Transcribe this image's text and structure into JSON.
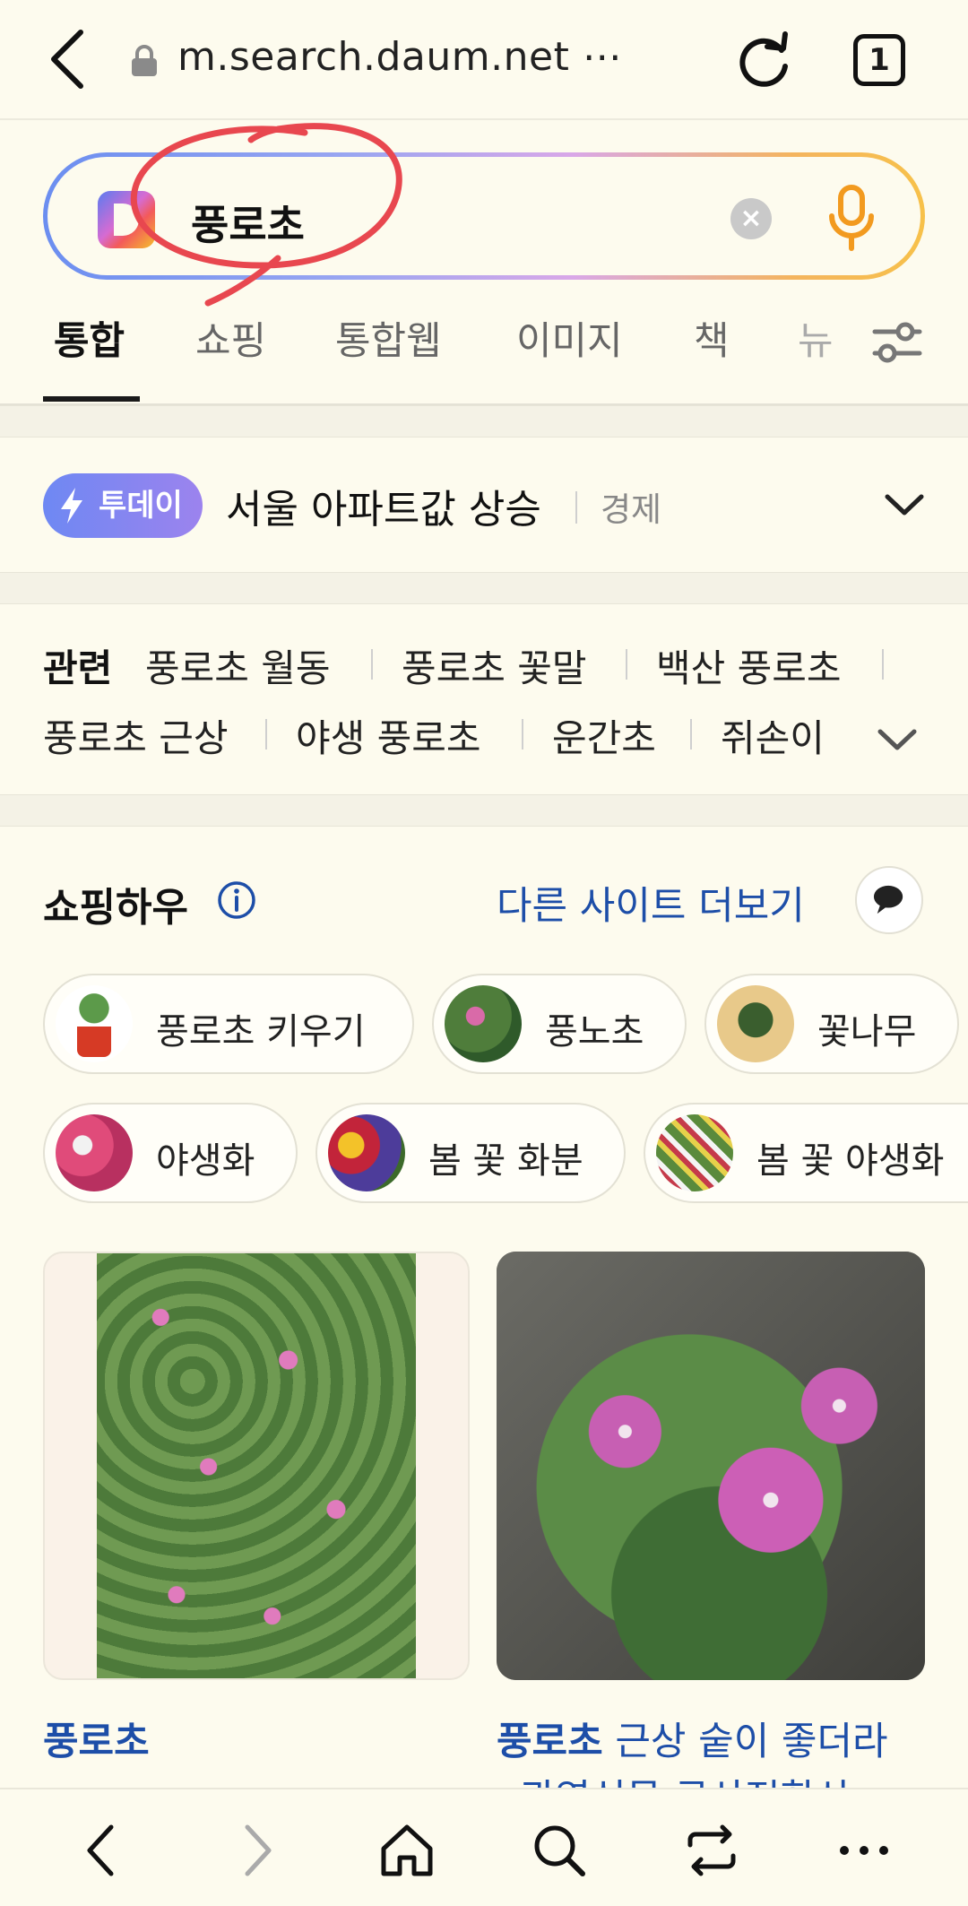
{
  "browser": {
    "url": "m.search.daum.net ⋯",
    "tab_count": "1"
  },
  "search": {
    "query": "풍로초"
  },
  "tabs": [
    {
      "label": "통합"
    },
    {
      "label": "쇼핑"
    },
    {
      "label": "통합웹"
    },
    {
      "label": "이미지"
    },
    {
      "label": "책"
    },
    {
      "label": "뉴"
    }
  ],
  "today": {
    "badge": "투데이",
    "headline": "서울 아파트값 상승",
    "category": "경제"
  },
  "related": {
    "heading": "관련",
    "items": [
      "풍로초 월동",
      "풍로초 꽃말",
      "백산 풍로초",
      "풍로초 근상",
      "야생 풍로초",
      "운간초",
      "쥐손이"
    ]
  },
  "shopping_how": {
    "title": "쇼핑하우",
    "more_sites": "다른 사이트 더보기",
    "chips": [
      "풍로초 키우기",
      "풍노초",
      "꽃나무",
      "야생화",
      "봄 꽃 화분",
      "봄 꽃 야생화"
    ]
  },
  "products": [
    {
      "title": "풍로초"
    },
    {
      "title_bold": "풍로초",
      "title_rest": " 근상 숱이 좋더라",
      "title_line2": "관엽식물 국산정합상"
    }
  ],
  "colors": {
    "link_blue": "#1d4ea8",
    "background": "#fdfbee",
    "today_badge": "#7b86f1",
    "annotation_red": "#e8474f"
  },
  "icons": [
    "back-arrow-icon",
    "lock-icon",
    "reload-icon",
    "mic-icon",
    "clear-icon",
    "filter-icon",
    "bolt-icon",
    "chevron-down-icon",
    "info-icon",
    "chat-icon",
    "nav-back-icon",
    "nav-forward-icon",
    "home-icon",
    "search-icon",
    "tabs-switch-icon",
    "more-icon"
  ]
}
